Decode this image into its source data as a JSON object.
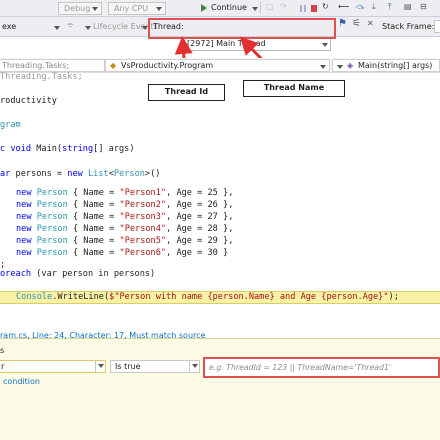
{
  "toolbar": {
    "config": "Debug",
    "platform": "Any CPU",
    "continue_label": "Continue",
    "exe_label": "exe",
    "lifecycle_label": "Lifecycle Events",
    "thread_label": "Thread:",
    "thread_value": "[2972] Main Thread",
    "stack_frame_label": "Stack Frame:"
  },
  "nav": {
    "left": "Threading.Tasks;",
    "middle": "VsProductivity.Program",
    "right": "Main(string[] args)"
  },
  "annotations": {
    "thread_id": "Thread Id",
    "thread_name": "Thread Name"
  },
  "code": {
    "line1": "roductivity",
    "line2": "gram",
    "line3_kw": "c void ",
    "line3_name": "Main(",
    "line3_type": "string",
    "line3_rest": "[] args)",
    "line4_kw": "ar",
    "line4_mid": " persons = ",
    "line4_new": "new ",
    "line4_type": "List",
    "line4_lt": "<",
    "line4_type2": "Person",
    "line4_gt": ">()",
    "persons": [
      {
        "name": "\"Person1\"",
        "age": "25"
      },
      {
        "name": "\"Person2\"",
        "age": "26"
      },
      {
        "name": "\"Person3\"",
        "age": "27"
      },
      {
        "name": "\"Person4\"",
        "age": "28"
      },
      {
        "name": "\"Person5\"",
        "age": "29"
      },
      {
        "name": "\"Person6\"",
        "age": "30"
      }
    ],
    "new_kw": "new",
    "person_type": "Person",
    "name_prop": " { Name = ",
    "age_prop": ", Age = ",
    "close_comma": " },",
    "close_last": " }",
    "close_list": ";",
    "foreach_kw": "oreach",
    "foreach_rest": " (var person in persons)",
    "console_type": "Console",
    "writeline": ".WriteLine(",
    "interp": "$\"Person with name {person.Name} and Age {person.Age}\"",
    "end": ");"
  },
  "panel": {
    "location": "ram.cs, Line: 24, Character: 17, Must match source",
    "conditions_label": "s",
    "condition_type": "r",
    "condition_op": "Is true",
    "expr_placeholder": "e.g. ThreadId = 123 || ThreadName='Thread1'",
    "actions_label": "condition"
  }
}
